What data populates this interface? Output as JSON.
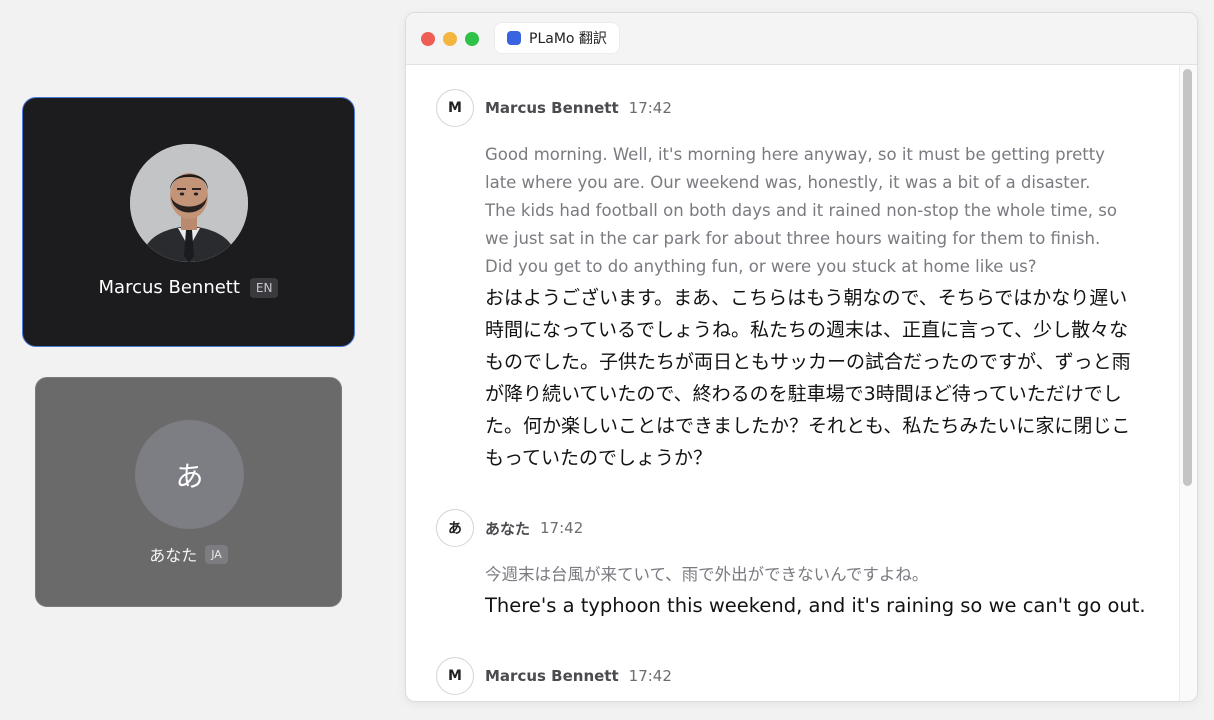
{
  "participants": {
    "remote": {
      "name": "Marcus Bennett",
      "lang": "EN"
    },
    "self": {
      "initial": "あ",
      "name": "あなた",
      "lang": "JA"
    }
  },
  "window": {
    "tab_title": "PLaMo 翻訳"
  },
  "messages": [
    {
      "avatar": "M",
      "sender": "Marcus Bennett",
      "time": "17:42",
      "original": "Good morning. Well, it's morning here anyway, so it must be getting pretty late where you are. Our weekend was, honestly, it was a bit of a disaster. The kids had football on both days and it rained non-stop the whole time, so we just sat in the car park for about three hours waiting for them to finish. Did you get to do anything fun, or were you stuck at home like us?",
      "translation": "おはようございます。まあ、こちらはもう朝なので、そちらではかなり遅い時間になっているでしょうね。私たちの週末は、正直に言って、少し散々なものでした。子供たちが両日ともサッカーの試合だったのですが、ずっと雨が降り続いていたので、終わるのを駐車場で3時間ほど待っていただけでした。何か楽しいことはできましたか？それとも、私たちみたいに家に閉じこもっていたのでしょうか？"
    },
    {
      "avatar": "あ",
      "sender": "あなた",
      "time": "17:42",
      "original": "今週末は台風が来ていて、雨で外出ができないんですよね。",
      "translation": "There's a typhoon this weekend, and it's raining so we can't go out."
    },
    {
      "avatar": "M",
      "sender": "Marcus Bennett",
      "time": "17:42"
    }
  ],
  "colors": {
    "accent": "#3a63e0",
    "tile_border": "#4a7bd8"
  }
}
